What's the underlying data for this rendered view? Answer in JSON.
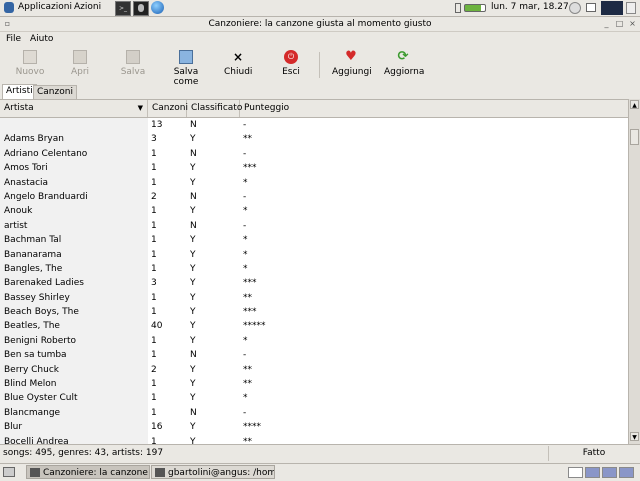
{
  "top_panel": {
    "applications": "Applicazioni",
    "actions": "Azioni",
    "clock": "lun. 7 mar, 18.27"
  },
  "window": {
    "title": "Canzoniere: la canzone giusta al momento giusto"
  },
  "menubar": {
    "file": "File",
    "help": "Aiuto"
  },
  "toolbar": {
    "new": "Nuovo",
    "open": "Apri",
    "save": "Salva",
    "save_as": "Salva come",
    "close": "Chiudi",
    "quit": "Esci",
    "add": "Aggiungi",
    "refresh": "Aggiorna"
  },
  "tabs": {
    "artists": "Artisti",
    "songs": "Canzoni"
  },
  "table": {
    "columns": [
      "Artista",
      "Canzoni",
      "Classificato",
      "Punteggio"
    ],
    "rows": [
      [
        "",
        "13",
        "N",
        "-"
      ],
      [
        "Adams Bryan",
        "3",
        "Y",
        "**"
      ],
      [
        "Adriano Celentano",
        "1",
        "N",
        "-"
      ],
      [
        "Amos Tori",
        "1",
        "Y",
        "***"
      ],
      [
        "Anastacia",
        "1",
        "Y",
        "*"
      ],
      [
        "Angelo Branduardi",
        "2",
        "N",
        "-"
      ],
      [
        "Anouk",
        "1",
        "Y",
        "*"
      ],
      [
        "artist",
        "1",
        "N",
        "-"
      ],
      [
        "Bachman Tal",
        "1",
        "Y",
        "*"
      ],
      [
        "Bananarama",
        "1",
        "Y",
        "*"
      ],
      [
        "Bangles, The",
        "1",
        "Y",
        "*"
      ],
      [
        "Barenaked Ladies",
        "3",
        "Y",
        "***"
      ],
      [
        "Bassey Shirley",
        "1",
        "Y",
        "**"
      ],
      [
        "Beach Boys, The",
        "1",
        "Y",
        "***"
      ],
      [
        "Beatles, The",
        "40",
        "Y",
        "*****"
      ],
      [
        "Benigni Roberto",
        "1",
        "Y",
        "*"
      ],
      [
        "Ben sa tumba",
        "1",
        "N",
        "-"
      ],
      [
        "Berry Chuck",
        "2",
        "Y",
        "**"
      ],
      [
        "Blind Melon",
        "1",
        "Y",
        "**"
      ],
      [
        "Blue Oyster Cult",
        "1",
        "Y",
        "*"
      ],
      [
        "Blancmange",
        "1",
        "N",
        "-"
      ],
      [
        "Blur",
        "16",
        "Y",
        "****"
      ],
      [
        "Bocelli Andrea",
        "1",
        "Y",
        "**"
      ]
    ]
  },
  "statusbar": {
    "summary": "songs: 495, genres: 43, artists: 197",
    "state": "Fatto"
  },
  "taskbar": {
    "task1": "Canzoniere: la canzone giu",
    "task2": "gbartolini@angus: /home/g"
  }
}
